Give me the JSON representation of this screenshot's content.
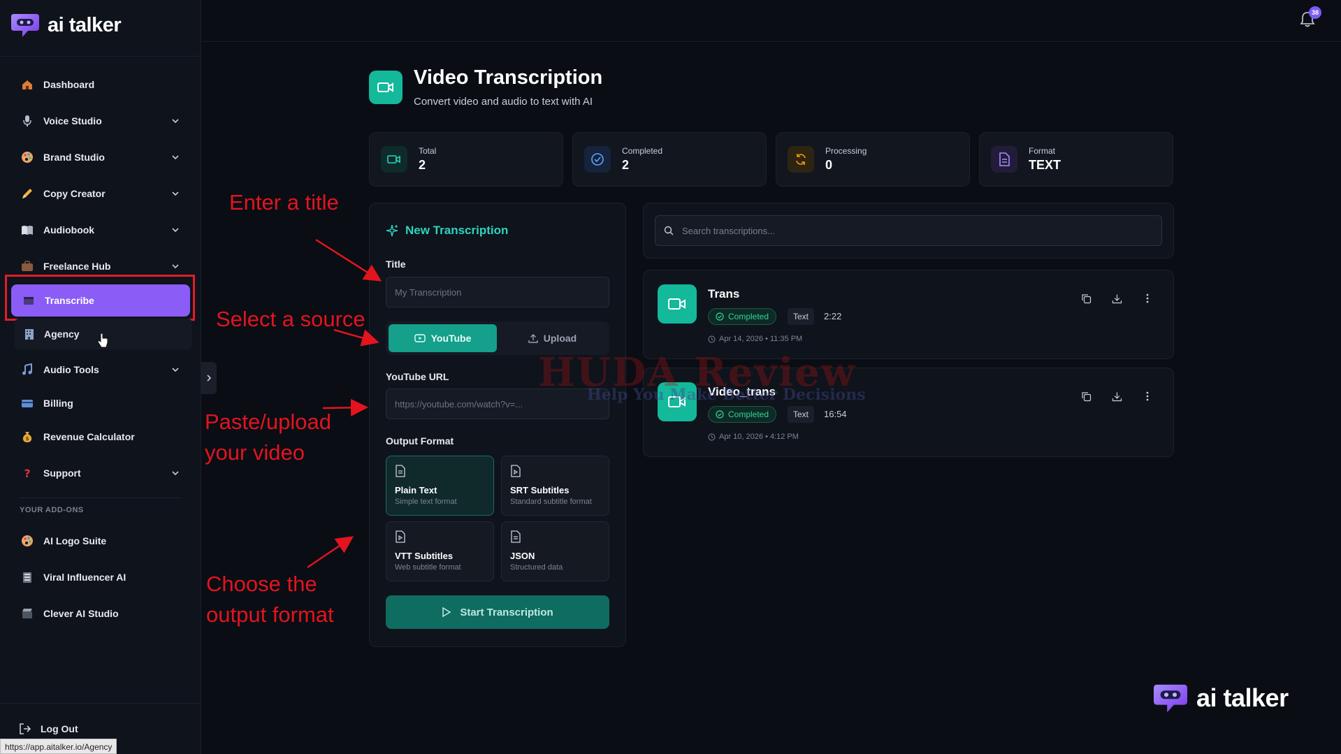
{
  "brand": {
    "name": "ai talker"
  },
  "sidebar": {
    "items": [
      {
        "label": "Dashboard",
        "icon": "home-icon"
      },
      {
        "label": "Voice Studio",
        "icon": "microphone-icon"
      },
      {
        "label": "Brand Studio",
        "icon": "palette-icon"
      },
      {
        "label": "Copy Creator",
        "icon": "pen-icon"
      },
      {
        "label": "Audiobook",
        "icon": "book-icon"
      },
      {
        "label": "Freelance Hub",
        "icon": "briefcase-icon"
      },
      {
        "label": "Transcribe",
        "icon": "film-icon"
      },
      {
        "label": "Agency",
        "icon": "building-icon"
      },
      {
        "label": "Audio Tools",
        "icon": "music-icon"
      },
      {
        "label": "Billing",
        "icon": "card-icon"
      },
      {
        "label": "Revenue Calculator",
        "icon": "money-bag-icon"
      },
      {
        "label": "Support",
        "icon": "question-icon"
      }
    ],
    "addons_title": "YOUR ADD-ONS",
    "addons": [
      {
        "label": "AI Logo Suite",
        "icon": "palette-icon"
      },
      {
        "label": "Viral Influencer AI",
        "icon": "clapper-icon"
      },
      {
        "label": "Clever AI Studio",
        "icon": "clapper-icon"
      }
    ],
    "logout": "Log Out"
  },
  "status_url": "https://app.aitalker.io/Agency",
  "notifications": {
    "count": "38"
  },
  "header": {
    "title": "Video Transcription",
    "subtitle": "Convert video and audio to text with AI"
  },
  "stats": [
    {
      "label": "Total",
      "value": "2"
    },
    {
      "label": "Completed",
      "value": "2"
    },
    {
      "label": "Processing",
      "value": "0"
    },
    {
      "label": "Format",
      "value": "TEXT"
    }
  ],
  "form": {
    "panel_title": "New Transcription",
    "title_label": "Title",
    "title_placeholder": "My Transcription",
    "source_youtube": "YouTube",
    "source_upload": "Upload",
    "url_label": "YouTube URL",
    "url_placeholder": "https://youtube.com/watch?v=...",
    "output_label": "Output Format",
    "formats": [
      {
        "name": "Plain Text",
        "desc": "Simple text format"
      },
      {
        "name": "SRT Subtitles",
        "desc": "Standard subtitle format"
      },
      {
        "name": "VTT Subtitles",
        "desc": "Web subtitle format"
      },
      {
        "name": "JSON",
        "desc": "Structured data"
      }
    ],
    "start_label": "Start Transcription"
  },
  "search": {
    "placeholder": "Search transcriptions..."
  },
  "transcriptions": [
    {
      "title": "Trans",
      "status": "Completed",
      "kind": "Text",
      "duration": "2:22",
      "date": "Apr 14, 2026 • 11:35 PM"
    },
    {
      "title": "Video_trans",
      "status": "Completed",
      "kind": "Text",
      "duration": "16:54",
      "date": "Apr 10, 2026 • 4:12 PM"
    }
  ],
  "annotations": {
    "title": "Enter a title",
    "source": "Select a source",
    "paste_1": "Paste/upload",
    "paste_2": "your video",
    "format_1": "Choose the",
    "format_2": "output format"
  },
  "watermark": {
    "main": "HUDA Review",
    "sub": "Help You Make Better Decisions"
  },
  "colors": {
    "accent": "#14b89b",
    "active_nav": "#8b5cf6",
    "annotation": "#e3141f"
  }
}
